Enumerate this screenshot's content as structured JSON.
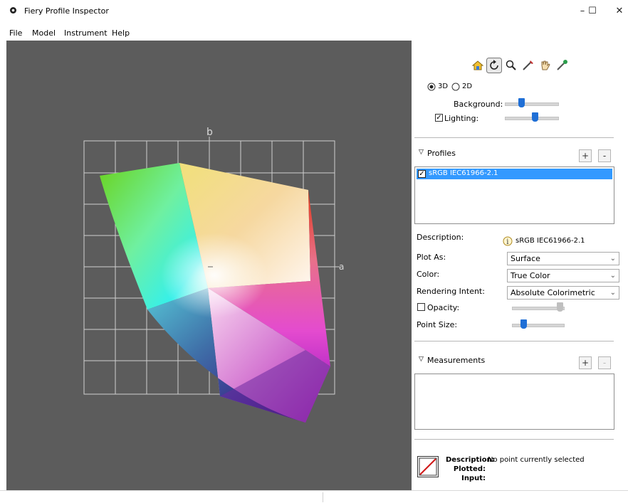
{
  "window": {
    "title": "Fiery Profile Inspector",
    "minimize": "–",
    "maximize": "☐",
    "close": "✕"
  },
  "menu": [
    "File",
    "Model",
    "Instrument",
    "Help"
  ],
  "plot": {
    "axis_b": "b",
    "axis_a": "a"
  },
  "toolbar": {
    "tools": [
      "home-icon",
      "rotate-icon",
      "zoom-icon",
      "eyedropper-icon",
      "hand-icon",
      "pin-icon"
    ],
    "active": "rotate-icon"
  },
  "view": {
    "mode_3d": "3D",
    "mode_2d": "2D",
    "selected": "3D"
  },
  "background": {
    "label": "Background:",
    "level": 0.35
  },
  "lighting": {
    "label": "Lighting:",
    "checked": true,
    "level": 0.55
  },
  "profiles": {
    "header": "Profiles",
    "add": "+",
    "remove": "-",
    "items": [
      {
        "name": "sRGB IEC61966-2.1",
        "checked": true
      }
    ]
  },
  "description": {
    "label": "Description:",
    "value": "sRGB IEC61966-2.1"
  },
  "plot_as": {
    "label": "Plot As:",
    "value": "Surface"
  },
  "color": {
    "label": "Color:",
    "value": "True Color"
  },
  "rendering_intent": {
    "label": "Rendering Intent:",
    "value": "Absolute Colorimetric"
  },
  "opacity": {
    "label": "Opacity:",
    "checked": false,
    "level": 0.95
  },
  "point_size": {
    "label": "Point Size:",
    "level": 0.2
  },
  "measurements": {
    "header": "Measurements",
    "add": "+",
    "remove": "-"
  },
  "info": {
    "description_label": "Description:",
    "description_value": "No point currently selected",
    "plotted_label": "Plotted:",
    "input_label": "Input:"
  }
}
